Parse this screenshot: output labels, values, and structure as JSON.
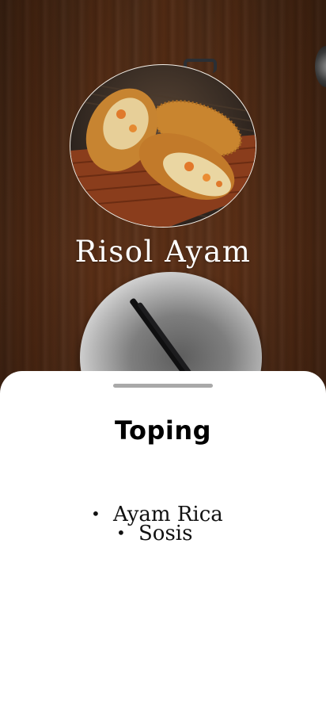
{
  "dish": {
    "title": "Risol Ayam",
    "image_subject": "fried-risol-rolls"
  },
  "sheet": {
    "title": "Toping",
    "toppings": [
      {
        "label": "Ayam Rica"
      },
      {
        "label": "Sosis"
      }
    ]
  },
  "colors": {
    "sheet_background": "#ffffff",
    "handle": "#a9a9a9",
    "title_text": "#ffffff",
    "wood_base": "#4b2916"
  }
}
